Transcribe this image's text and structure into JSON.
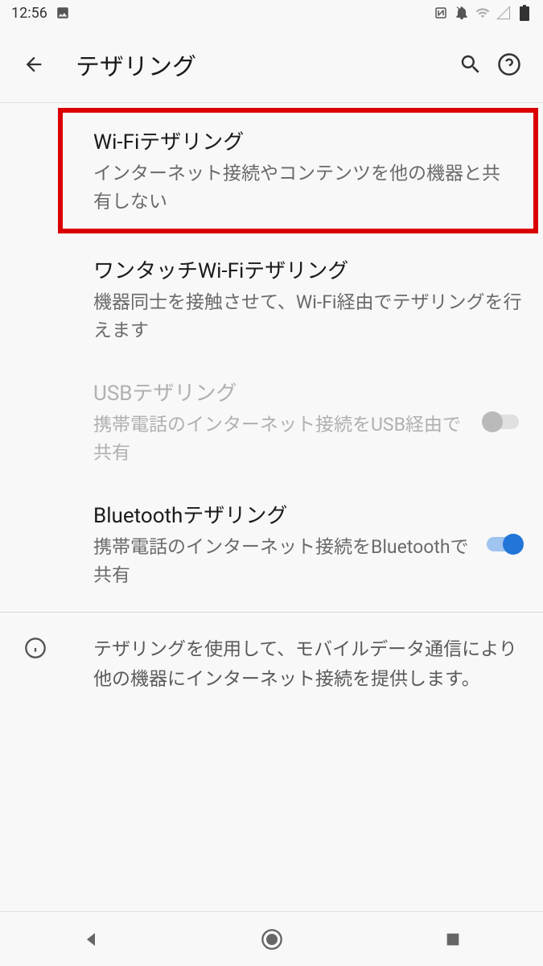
{
  "statusBar": {
    "time": "12:56"
  },
  "appBar": {
    "title": "テザリング"
  },
  "settings": [
    {
      "title": "Wi-Fiテザリング",
      "subtitle": "インターネット接続やコンテンツを他の機器と共有しない",
      "highlighted": true
    },
    {
      "title": "ワンタッチWi-Fiテザリング",
      "subtitle": "機器同士を接触させて、Wi-Fi経由でテザリングを行えます"
    },
    {
      "title": "USBテザリング",
      "subtitle": "携帯電話のインターネット接続をUSB経由で共有",
      "disabled": true,
      "switch": "off"
    },
    {
      "title": "Bluetoothテザリング",
      "subtitle": "携帯電話のインターネット接続をBluetoothで共有",
      "switch": "on"
    }
  ],
  "infoText": "テザリングを使用して、モバイルデータ通信により他の機器にインターネット接続を提供します。"
}
